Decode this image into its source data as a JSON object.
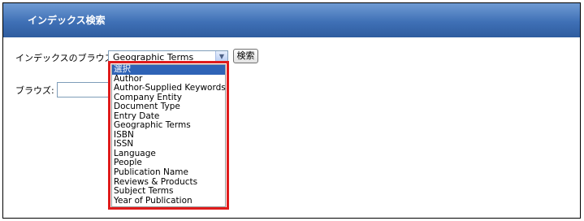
{
  "header": {
    "title": "インデックス検索"
  },
  "index_browse": {
    "label": "インデックスのブラウズ:",
    "selected_value": "Geographic Terms",
    "search_button_label": "検索"
  },
  "browse": {
    "label": "ブラウズ:",
    "value": ""
  },
  "dropdown": {
    "options": [
      "選択",
      "Author",
      "Author-Supplied Keywords",
      "Company Entity",
      "Document Type",
      "Entry Date",
      "Geographic Terms",
      "ISBN",
      "ISSN",
      "Language",
      "People",
      "Publication Name",
      "Reviews & Products",
      "Subject Terms",
      "Year of Publication"
    ],
    "highlighted_index": 0,
    "highlight_color": "#e01b1b",
    "selected_option_color": "#2f63b6"
  },
  "colors": {
    "header_blue": "#3f70b6",
    "header_text": "#ffffff"
  },
  "icons": {
    "dropdown_arrow": "chevron-down-icon"
  }
}
